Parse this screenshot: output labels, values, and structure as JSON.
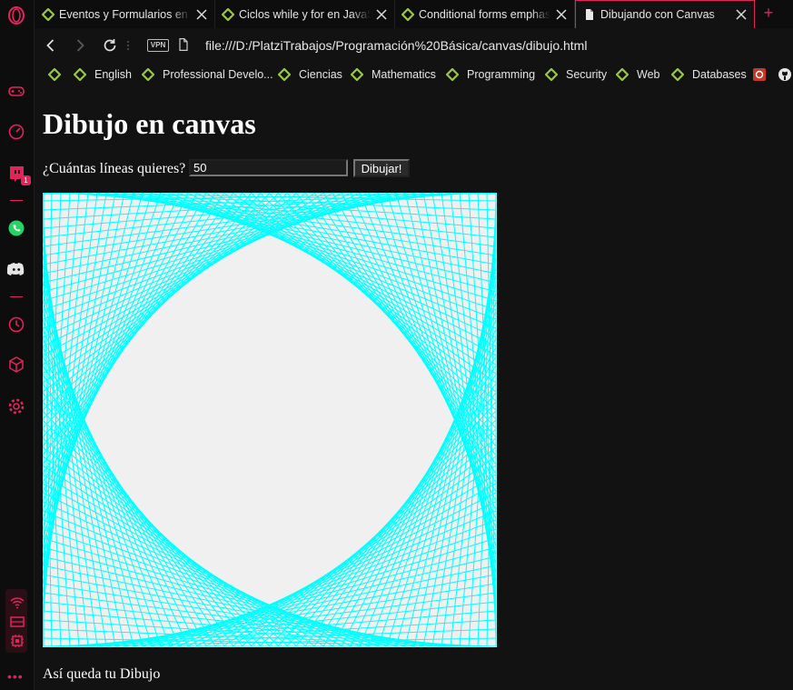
{
  "tabs": [
    {
      "title": "Eventos y Formularios en H",
      "active": false
    },
    {
      "title": "Ciclos while y for en JavaSc",
      "active": false
    },
    {
      "title": "Conditional forms emphasi",
      "active": false
    },
    {
      "title": "Dibujando con Canvas",
      "active": true
    }
  ],
  "address_bar": {
    "vpn_label": "VPN",
    "url": "file:///D:/PlatziTrabajos/Programación%20Básica/canvas/dibujo.html"
  },
  "bookmarks": [
    "",
    "English",
    "Professional Develo...",
    "Ciencias",
    "Mathematics",
    "Programming",
    "Security",
    "Web",
    "Databases"
  ],
  "sidebar": {
    "twitch_badge": "1"
  },
  "page": {
    "title": "Dibujo en canvas",
    "prompt_label": "¿Cuántas líneas quieres?",
    "lines_value": "50",
    "draw_button_label": "Dibujar!",
    "caption": "Así queda tu Dibujo"
  },
  "canvas": {
    "line_count": 50,
    "line_color": "#00ffff",
    "background": "#f0f0f0"
  },
  "colors": {
    "accent": "#e3245a",
    "bookmark_green": "#7ed321"
  }
}
